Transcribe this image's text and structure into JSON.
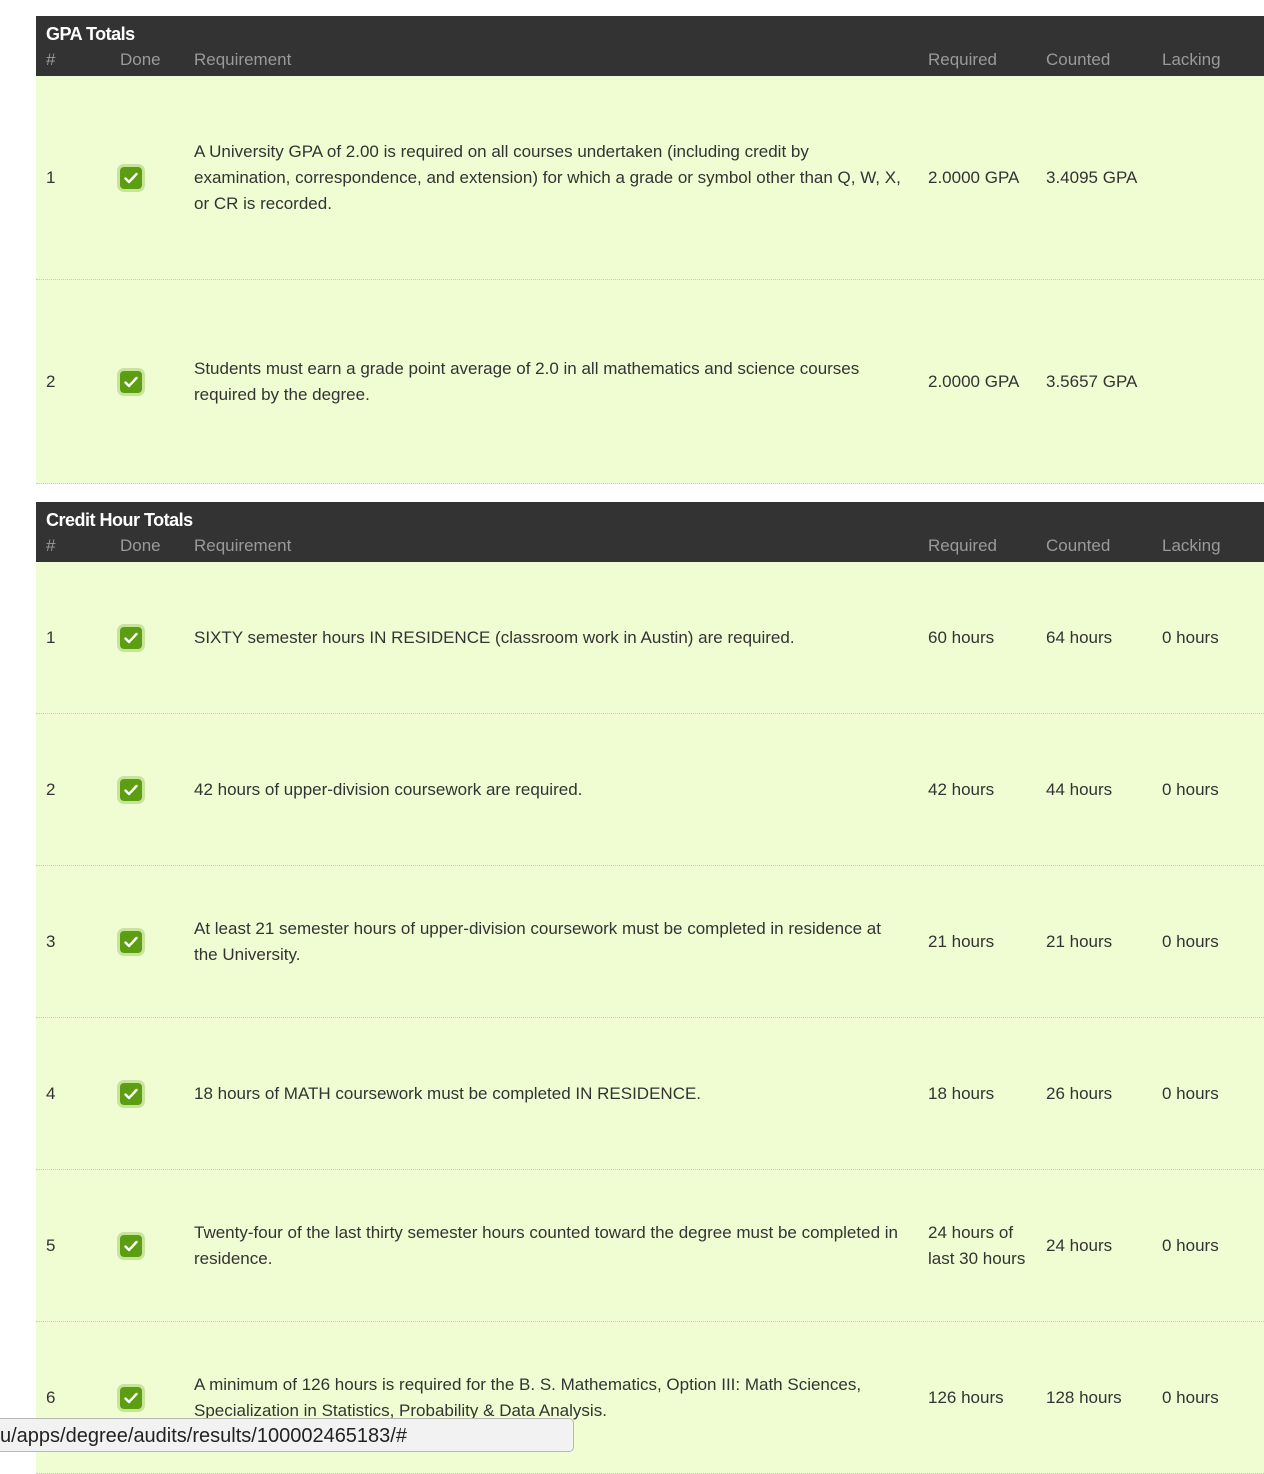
{
  "columns": {
    "num": "#",
    "done": "Done",
    "requirement": "Requirement",
    "required": "Required",
    "counted": "Counted",
    "lacking": "Lacking"
  },
  "gpa": {
    "title": "GPA Totals",
    "rows": [
      {
        "num": "1",
        "done": true,
        "requirement": "A University GPA of 2.00 is required on all courses undertaken (including credit by examination, correspondence, and extension) for which a grade or symbol other than Q, W, X, or CR is recorded.",
        "required": "2.0000 GPA",
        "counted": "3.4095 GPA",
        "lacking": ""
      },
      {
        "num": "2",
        "done": true,
        "requirement": "Students must earn a grade point average of 2.0 in all mathematics and science courses required by the degree.",
        "required": "2.0000 GPA",
        "counted": "3.5657 GPA",
        "lacking": ""
      }
    ]
  },
  "credit": {
    "title": "Credit Hour Totals",
    "rows": [
      {
        "num": "1",
        "done": true,
        "requirement": "SIXTY semester hours IN RESIDENCE (classroom work in Austin) are required.",
        "required": "60 hours",
        "counted": "64 hours",
        "lacking": "0 hours"
      },
      {
        "num": "2",
        "done": true,
        "requirement": "42 hours of upper-division coursework are required.",
        "required": "42 hours",
        "counted": "44 hours",
        "lacking": "0 hours"
      },
      {
        "num": "3",
        "done": true,
        "requirement": "At least 21 semester hours of upper-division coursework must be completed in residence at the University.",
        "required": "21 hours",
        "counted": "21 hours",
        "lacking": "0 hours"
      },
      {
        "num": "4",
        "done": true,
        "requirement": "18 hours of MATH coursework must be completed IN RESIDENCE.",
        "required": "18 hours",
        "counted": "26 hours",
        "lacking": "0 hours"
      },
      {
        "num": "5",
        "done": true,
        "requirement": "Twenty-four of the last thirty semester hours counted toward the degree must be completed in residence.",
        "required": "24 hours of last 30 hours",
        "counted": "24 hours",
        "lacking": "0 hours"
      },
      {
        "num": "6",
        "done": true,
        "requirement": "A minimum of 126 hours is required for the B. S. Mathematics, Option III: Math Sciences, Specialization in Statistics, Probability & Data Analysis.",
        "required": "126 hours",
        "counted": "128 hours",
        "lacking": "0 hours"
      }
    ]
  },
  "status_url": "u/apps/degree/audits/results/100002465183/#",
  "colors": {
    "header_bg": "#333333",
    "row_bg": "#f0fdd3",
    "check_bg": "#5d9d12"
  },
  "icons": {
    "done": "checkbox-checked-icon"
  }
}
